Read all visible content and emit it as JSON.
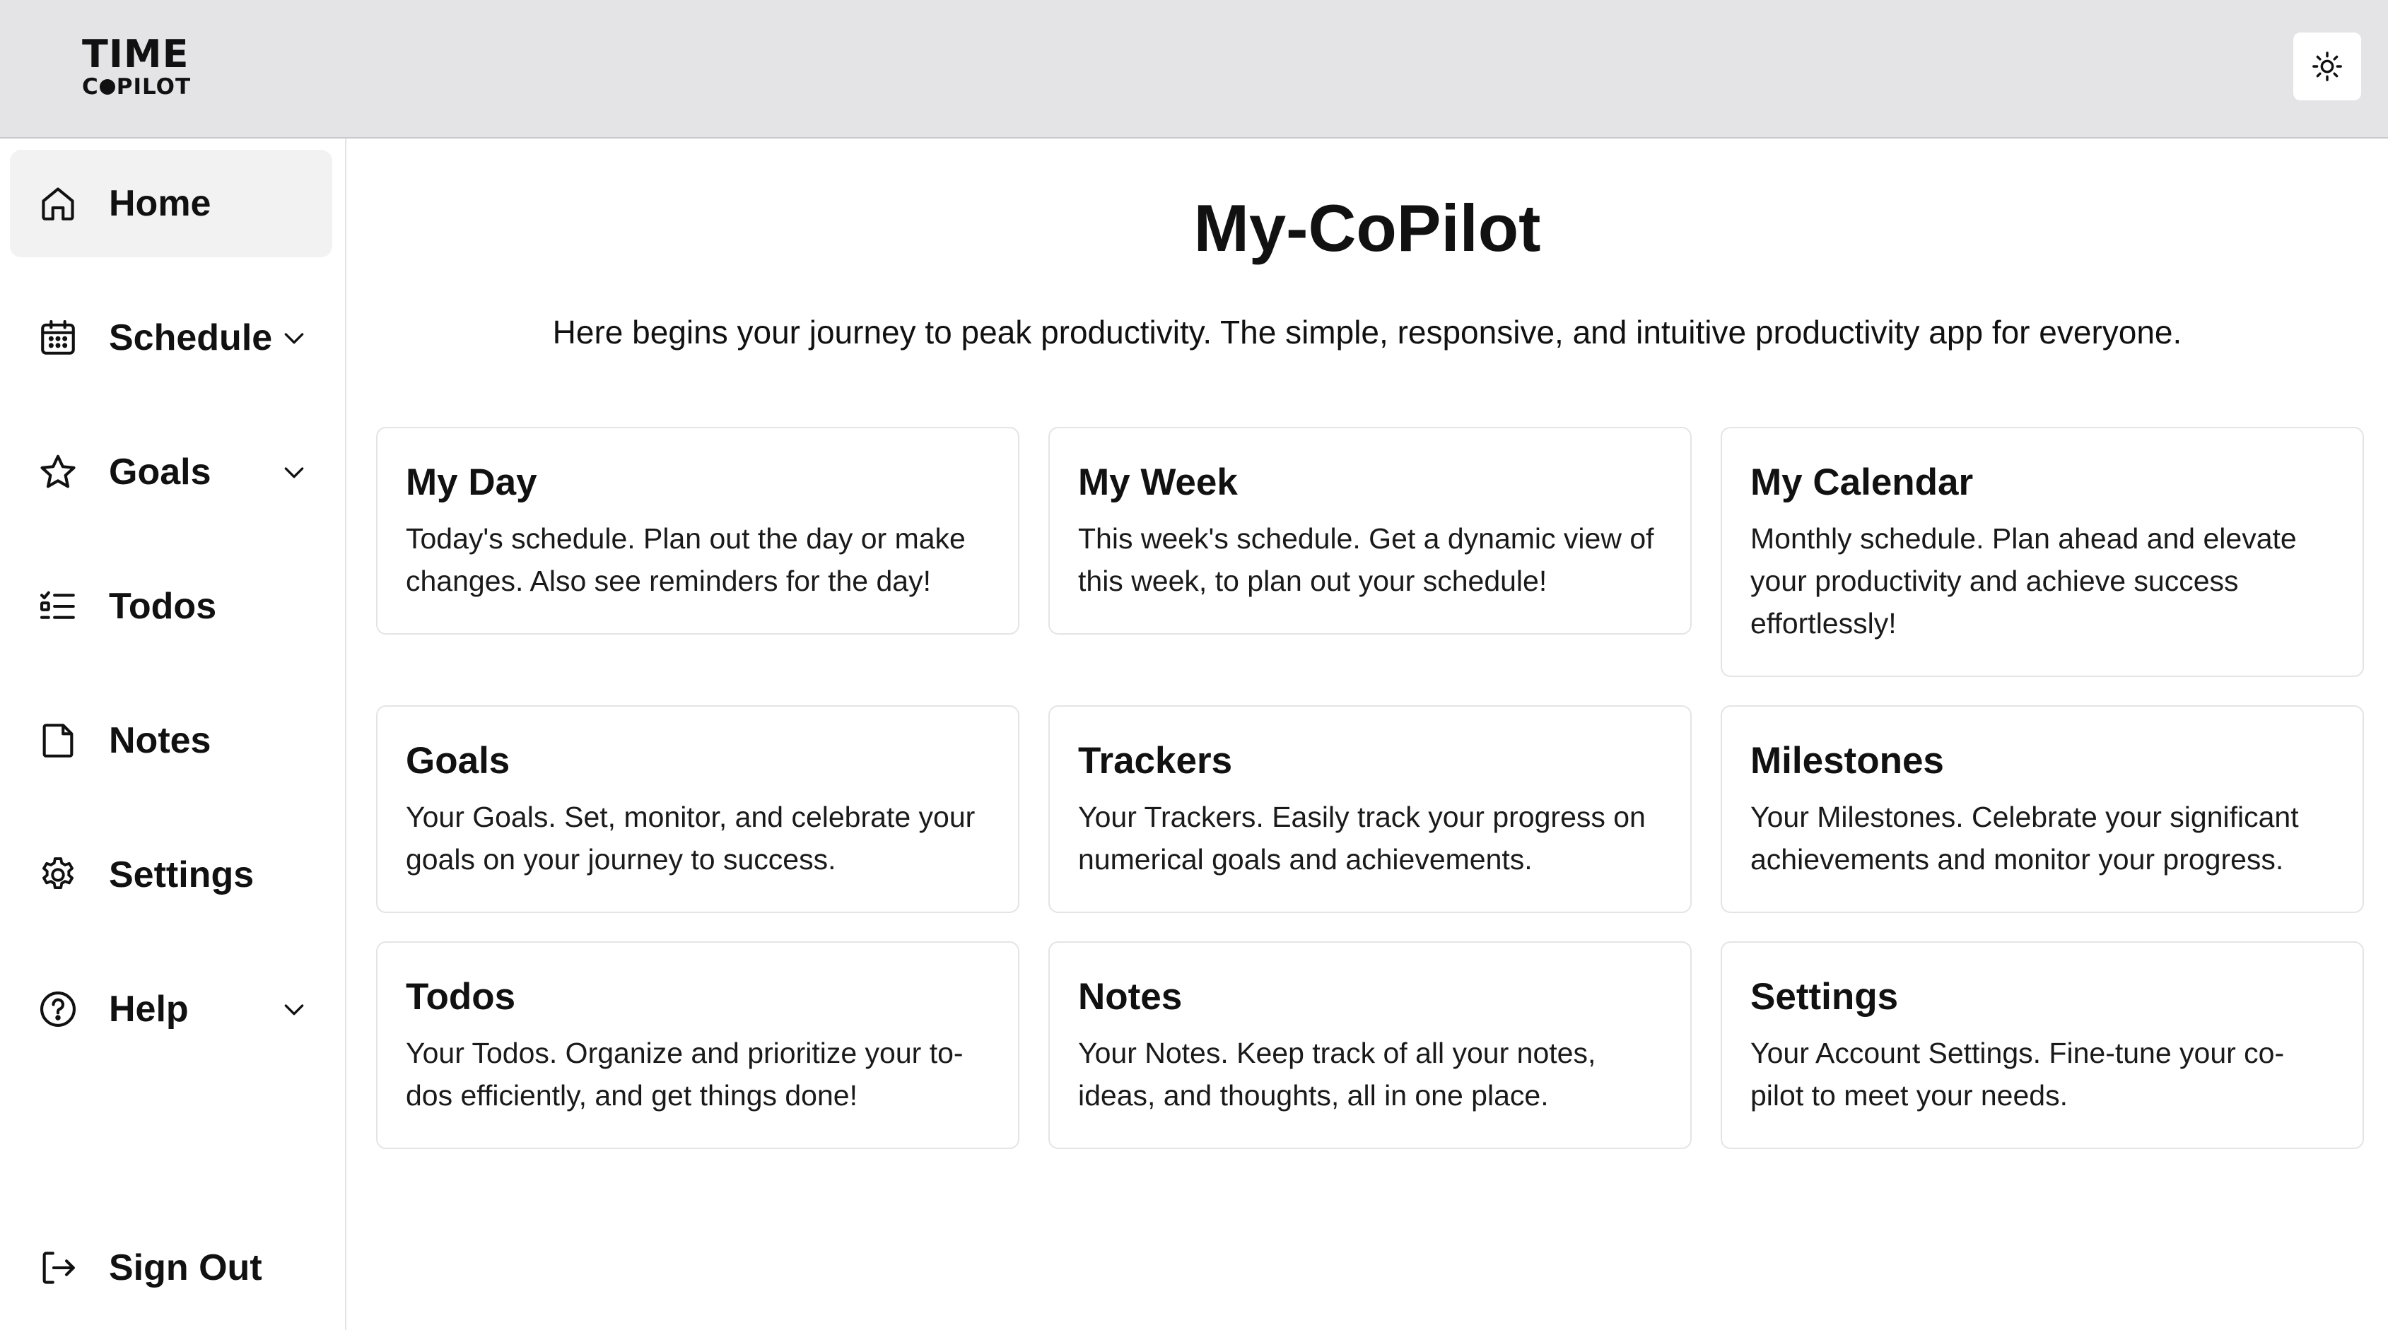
{
  "header": {
    "logo_top": "TIME",
    "logo_bottom_prefix": "C",
    "logo_bottom_suffix": "PILOT",
    "theme_toggle_icon": "sun-icon"
  },
  "sidebar": {
    "items": [
      {
        "label": "Home",
        "icon": "home-icon",
        "active": true,
        "has_chevron": false
      },
      {
        "label": "Schedule",
        "icon": "calendar-icon",
        "active": false,
        "has_chevron": true
      },
      {
        "label": "Goals",
        "icon": "star-icon",
        "active": false,
        "has_chevron": true
      },
      {
        "label": "Todos",
        "icon": "checklist-icon",
        "active": false,
        "has_chevron": false
      },
      {
        "label": "Notes",
        "icon": "note-icon",
        "active": false,
        "has_chevron": false
      },
      {
        "label": "Settings",
        "icon": "gear-icon",
        "active": false,
        "has_chevron": false
      },
      {
        "label": "Help",
        "icon": "help-circle-icon",
        "active": false,
        "has_chevron": true
      }
    ],
    "sign_out": {
      "label": "Sign Out",
      "icon": "sign-out-icon"
    }
  },
  "main": {
    "title": "My-CoPilot",
    "subtitle": "Here begins your journey to peak productivity. The simple, responsive, and intuitive productivity app for everyone.",
    "cards": [
      {
        "title": "My Day",
        "description": "Today's schedule. Plan out the day or make changes. Also see reminders for the day!"
      },
      {
        "title": "My Week",
        "description": "This week's schedule. Get a dynamic view of this week, to plan out your schedule!"
      },
      {
        "title": "My Calendar",
        "description": "Monthly schedule. Plan ahead and elevate your productivity and achieve success effortlessly!"
      },
      {
        "title": "Goals",
        "description": "Your Goals. Set, monitor, and celebrate your goals on your journey to success."
      },
      {
        "title": "Trackers",
        "description": "Your Trackers. Easily track your progress on numerical goals and achievements."
      },
      {
        "title": "Milestones",
        "description": "Your Milestones. Celebrate your significant achievements and monitor your progress."
      },
      {
        "title": "Todos",
        "description": "Your Todos. Organize and prioritize your to-dos efficiently, and get things done!"
      },
      {
        "title": "Notes",
        "description": "Your Notes. Keep track of all your notes, ideas, and thoughts, all in one place."
      },
      {
        "title": "Settings",
        "description": "Your Account Settings. Fine-tune your co-pilot to meet your needs."
      }
    ]
  },
  "colors": {
    "header_bg": "#e4e4e7",
    "active_nav_bg": "#f2f2f3",
    "card_border": "#e4e4e7",
    "text": "#111111"
  }
}
